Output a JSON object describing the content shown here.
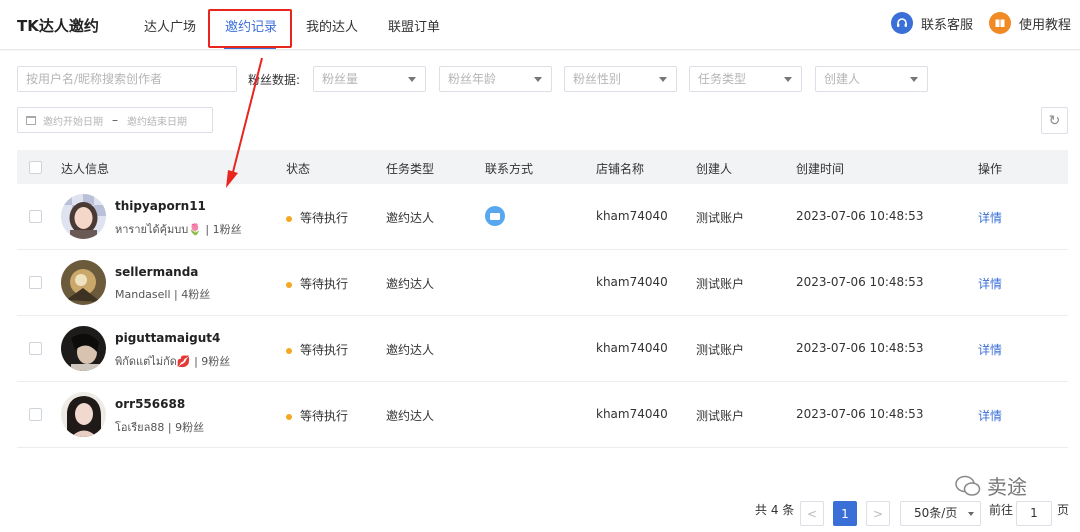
{
  "brand": "TK达人邀约",
  "nav": [
    {
      "label": "达人广场"
    },
    {
      "label": "邀约记录",
      "active": true
    },
    {
      "label": "我的达人"
    },
    {
      "label": "联盟订单"
    }
  ],
  "top_right": {
    "service": "联系客服",
    "tutorial": "使用教程"
  },
  "filters": {
    "search_placeholder": "按用户名/昵称搜索创作者",
    "fans_label": "粉丝数据:",
    "selects": [
      "粉丝量",
      "粉丝年龄",
      "粉丝性别",
      "任务类型",
      "创建人"
    ],
    "date_start": "邀约开始日期",
    "date_sep": "–",
    "date_end": "邀约结束日期",
    "refresh_glyph": "↻"
  },
  "table": {
    "headers": [
      "达人信息",
      "状态",
      "任务类型",
      "联系方式",
      "店铺名称",
      "创建人",
      "创建时间",
      "操作"
    ],
    "rows": [
      {
        "name": "thipyaporn11",
        "sub": "หารายได้คุ้มบบ🌷 | 1粉丝",
        "status": "等待执行",
        "task": "邀约达人",
        "contact": "mail-icon",
        "shop": "kham74040",
        "creator": "测试账户",
        "time": "2023-07-06 10:48:53",
        "action": "详情"
      },
      {
        "name": "sellermanda",
        "sub": "Mandasell | 4粉丝",
        "status": "等待执行",
        "task": "邀约达人",
        "contact": "",
        "shop": "kham74040",
        "creator": "测试账户",
        "time": "2023-07-06 10:48:53",
        "action": "详情"
      },
      {
        "name": "piguttamaigut4",
        "sub": "พิกัดแต่ไม่กัด💋 | 9粉丝",
        "status": "等待执行",
        "task": "邀约达人",
        "contact": "",
        "shop": "kham74040",
        "creator": "测试账户",
        "time": "2023-07-06 10:48:53",
        "action": "详情"
      },
      {
        "name": "orr556688",
        "sub": "โอเรียล88 | 9粉丝",
        "status": "等待执行",
        "task": "邀约达人",
        "contact": "",
        "shop": "kham74040",
        "creator": "测试账户",
        "time": "2023-07-06 10:48:53",
        "action": "详情"
      }
    ]
  },
  "pagination": {
    "total": "共 4 条",
    "prev": "<",
    "page": "1",
    "next": ">",
    "page_size": "50条/页",
    "goto_label": "前往",
    "goto_value": "1",
    "page_suffix": "页"
  },
  "watermark": "卖途",
  "colors": {
    "accent": "#3a6fd8",
    "status_pending": "#f5a623",
    "annotation": "#e8261f"
  }
}
